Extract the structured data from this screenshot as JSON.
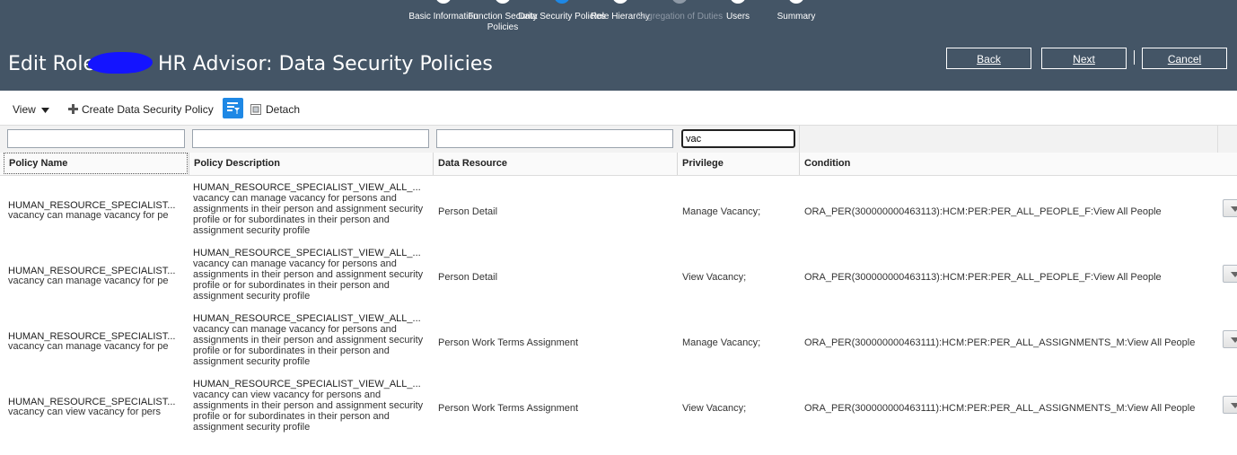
{
  "train": {
    "steps": [
      {
        "label": "Basic Information",
        "state": "done"
      },
      {
        "label": "Function Security Policies",
        "state": "done"
      },
      {
        "label": "Data Security Policies",
        "state": "current"
      },
      {
        "label": "Role Hierarchy",
        "state": "done"
      },
      {
        "label": "Segregation of Duties",
        "state": "disabled"
      },
      {
        "label": "Users",
        "state": "done"
      },
      {
        "label": "Summary",
        "state": "done"
      }
    ]
  },
  "header": {
    "title_prefix": "Edit Role",
    "title_suffix": "HR Advisor: Data Security Policies",
    "back_label": "Back",
    "next_label": "Next",
    "cancel_label": "Cancel",
    "background_color": "#445566"
  },
  "toolbar": {
    "view_label": "View",
    "create_label": "Create Data Security Policy",
    "detach_label": "Detach",
    "icons": [
      "caret-down-icon",
      "plus-icon",
      "query-by-example-icon",
      "detach-icon"
    ]
  },
  "table": {
    "filters": {
      "policy_name": "",
      "policy_description": "",
      "data_resource": "",
      "privilege": "vac"
    },
    "columns": [
      "Policy Name",
      "Policy Description",
      "Data Resource",
      "Privilege",
      "Condition"
    ],
    "rows": [
      {
        "name": "HUMAN_RESOURCE_SPECIALIST...",
        "name_sub": "vacancy can manage vacancy for pe",
        "desc_title": "HUMAN_RESOURCE_SPECIALIST_VIEW_ALL_...",
        "desc_body": "vacancy can manage vacancy for persons and assignments in their person and assignment security profile or for subordinates in their person and assignment security profile",
        "resource": "Person Detail",
        "privilege": "Manage Vacancy;",
        "condition": "ORA_PER(300000000463113):HCM:PER:PER_ALL_PEOPLE_F:View All People"
      },
      {
        "name": "HUMAN_RESOURCE_SPECIALIST...",
        "name_sub": "vacancy can manage vacancy for pe",
        "desc_title": "HUMAN_RESOURCE_SPECIALIST_VIEW_ALL_...",
        "desc_body": "vacancy can manage vacancy for persons and assignments in their person and assignment security profile or for subordinates in their person and assignment security profile",
        "resource": "Person Detail",
        "privilege": "View Vacancy;",
        "condition": "ORA_PER(300000000463113):HCM:PER:PER_ALL_PEOPLE_F:View All People"
      },
      {
        "name": "HUMAN_RESOURCE_SPECIALIST...",
        "name_sub": "vacancy can manage vacancy for pe",
        "desc_title": "HUMAN_RESOURCE_SPECIALIST_VIEW_ALL_...",
        "desc_body": "vacancy can manage vacancy for persons and assignments in their person and assignment security profile or for subordinates in their person and assignment security profile",
        "resource": "Person Work Terms Assignment",
        "privilege": "Manage Vacancy;",
        "condition": "ORA_PER(300000000463111):HCM:PER:PER_ALL_ASSIGNMENTS_M:View All People"
      },
      {
        "name": "HUMAN_RESOURCE_SPECIALIST...",
        "name_sub": "vacancy can view vacancy for pers",
        "desc_title": "HUMAN_RESOURCE_SPECIALIST_VIEW_ALL_...",
        "desc_body": "vacancy can view vacancy for persons and assignments in their person and assignment security profile or for subordinates in their person and assignment security profile",
        "resource": "Person Work Terms Assignment",
        "privilege": "View Vacancy;",
        "condition": "ORA_PER(300000000463111):HCM:PER:PER_ALL_ASSIGNMENTS_M:View All People"
      }
    ]
  }
}
